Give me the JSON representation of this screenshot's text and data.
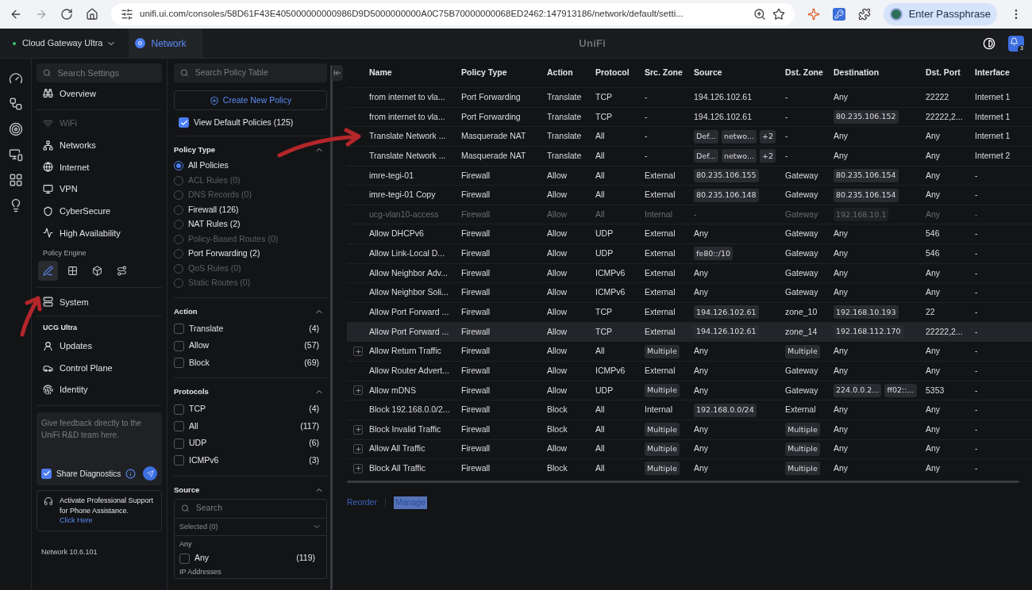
{
  "browser": {
    "url": "unifi.ui.com/consoles/58D61F43E405000000000986D9D5000000000A0C75B70000000068ED2462:147913186/network/default/setti...",
    "profile_button": "Enter Passphrase"
  },
  "header": {
    "console": "Cloud Gateway Ultra",
    "app_tab": "Network",
    "logo": "UniFi",
    "notification_count": "3"
  },
  "nav": {
    "search_placeholder": "Search Settings",
    "items": [
      {
        "label": "Overview",
        "disabled": false
      },
      {
        "label": "WiFi",
        "disabled": true
      },
      {
        "label": "Networks",
        "disabled": false
      },
      {
        "label": "Internet",
        "disabled": false
      },
      {
        "label": "VPN",
        "disabled": false
      },
      {
        "label": "CyberSecure",
        "disabled": false
      },
      {
        "label": "High Availability",
        "disabled": false
      }
    ],
    "policy_engine_label": "Policy Engine",
    "policy_tools": [
      {
        "selected": true
      },
      {
        "selected": false
      },
      {
        "selected": false
      },
      {
        "selected": false
      }
    ],
    "system": "System",
    "device_heading": "UCG Ultra",
    "device_items": [
      "Updates",
      "Control Plane",
      "Identity"
    ],
    "feedback_placeholder": "Give feedback directly to the UniFi R&D team here.",
    "share_diagnostics": {
      "label": "Share Diagnostics",
      "checked": true
    },
    "support": {
      "text": "Activate Professional Support for Phone Assistance.",
      "link": "Click Here"
    },
    "version": "Network 10.6.101"
  },
  "filters": {
    "search_placeholder": "Search Policy Table",
    "create_button": "Create New Policy",
    "view_default": {
      "label": "View Default Policies (125)",
      "checked": true
    },
    "policy_type": {
      "title": "Policy Type",
      "options": [
        {
          "label": "All Policies",
          "selected": true,
          "disabled": false
        },
        {
          "label": "ACL Rules (0)",
          "selected": false,
          "disabled": true
        },
        {
          "label": "DNS Records (0)",
          "selected": false,
          "disabled": true
        },
        {
          "label": "Firewall (126)",
          "selected": false,
          "disabled": false
        },
        {
          "label": "NAT Rules (2)",
          "selected": false,
          "disabled": false
        },
        {
          "label": "Policy-Based Routes (0)",
          "selected": false,
          "disabled": true
        },
        {
          "label": "Port Forwarding (2)",
          "selected": false,
          "disabled": false
        },
        {
          "label": "QoS Rules (0)",
          "selected": false,
          "disabled": true
        },
        {
          "label": "Static Routes (0)",
          "selected": false,
          "disabled": true
        }
      ]
    },
    "groups": [
      {
        "title": "Action",
        "options": [
          {
            "label": "Translate",
            "count": "(4)",
            "checked": false
          },
          {
            "label": "Allow",
            "count": "(57)",
            "checked": false
          },
          {
            "label": "Block",
            "count": "(69)",
            "checked": false
          }
        ]
      },
      {
        "title": "Protocols",
        "options": [
          {
            "label": "TCP",
            "count": "(4)",
            "checked": false
          },
          {
            "label": "All",
            "count": "(117)",
            "checked": false
          },
          {
            "label": "UDP",
            "count": "(6)",
            "checked": false
          },
          {
            "label": "ICMPv6",
            "count": "(3)",
            "checked": false
          }
        ]
      }
    ],
    "source": {
      "title": "Source",
      "search_placeholder": "Search",
      "selected_dropdown": "Selected (0)",
      "group_label": "Any",
      "option": {
        "label": "Any",
        "count": "(119)",
        "checked": false
      },
      "next_group_label": "IP Addresses"
    }
  },
  "table": {
    "columns": [
      "Name",
      "Policy Type",
      "Action",
      "Protocol",
      "Src. Zone",
      "Source",
      "Dst. Zone",
      "Destination",
      "Dst. Port",
      "Interface"
    ],
    "rows": [
      {
        "expandable": false,
        "disabled": false,
        "hovered": false,
        "cells": [
          "from internet to vla...",
          "Port Forwarding",
          "Translate",
          "TCP",
          "-",
          "194.126.102.61",
          "-",
          "Any",
          "22222",
          "Internet 1"
        ]
      },
      {
        "expandable": false,
        "disabled": false,
        "hovered": false,
        "cells": [
          "from internet to vla...",
          "Port Forwarding",
          "Translate",
          "TCP",
          "-",
          "194.126.102.61",
          "-",
          [
            "80.235.106.152"
          ],
          "22222,2...",
          "Internet 1"
        ]
      },
      {
        "expandable": false,
        "disabled": false,
        "hovered": false,
        "cells": [
          "Translate Network ...",
          "Masquerade NAT",
          "Translate",
          "All",
          "-",
          [
            "Def...",
            "netwo...",
            "+2"
          ],
          "-",
          "Any",
          "Any",
          "Internet 1"
        ]
      },
      {
        "expandable": false,
        "disabled": false,
        "hovered": false,
        "cells": [
          "Translate Network ...",
          "Masquerade NAT",
          "Translate",
          "All",
          "-",
          [
            "Def...",
            "netwo...",
            "+2"
          ],
          "-",
          "Any",
          "Any",
          "Internet 2"
        ]
      },
      {
        "expandable": false,
        "disabled": false,
        "hovered": false,
        "cells": [
          "imre-tegi-01",
          "Firewall",
          "Allow",
          "All",
          "External",
          [
            "80.235.106.155"
          ],
          "Gateway",
          [
            "80.235.106.154"
          ],
          "Any",
          "-"
        ]
      },
      {
        "expandable": false,
        "disabled": false,
        "hovered": false,
        "cells": [
          "imre-tegi-01 Copy",
          "Firewall",
          "Allow",
          "All",
          "External",
          [
            "80.235.106.148"
          ],
          "Gateway",
          [
            "80.235.106.154"
          ],
          "Any",
          "-"
        ]
      },
      {
        "expandable": false,
        "disabled": true,
        "hovered": false,
        "cells": [
          "ucg-vlan10-access",
          "Firewall",
          "Allow",
          "All",
          "Internal",
          "-",
          "Gateway",
          [
            "192.168.10.1"
          ],
          "Any",
          "-"
        ]
      },
      {
        "expandable": false,
        "disabled": false,
        "hovered": false,
        "cells": [
          "Allow DHCPv6",
          "Firewall",
          "Allow",
          "UDP",
          "External",
          "Any",
          "Gateway",
          "Any",
          "546",
          "-"
        ]
      },
      {
        "expandable": false,
        "disabled": false,
        "hovered": false,
        "cells": [
          "Allow Link-Local D...",
          "Firewall",
          "Allow",
          "UDP",
          "External",
          [
            "fe80::/10"
          ],
          "Gateway",
          "Any",
          "546",
          "-"
        ]
      },
      {
        "expandable": false,
        "disabled": false,
        "hovered": false,
        "cells": [
          "Allow Neighbor Adv...",
          "Firewall",
          "Allow",
          "ICMPv6",
          "External",
          "Any",
          "Gateway",
          "Any",
          "Any",
          "-"
        ]
      },
      {
        "expandable": false,
        "disabled": false,
        "hovered": false,
        "cells": [
          "Allow Neighbor Soli...",
          "Firewall",
          "Allow",
          "ICMPv6",
          "External",
          "Any",
          "Gateway",
          "Any",
          "Any",
          "-"
        ]
      },
      {
        "expandable": false,
        "disabled": false,
        "hovered": false,
        "cells": [
          "Allow Port Forward ...",
          "Firewall",
          "Allow",
          "TCP",
          "External",
          [
            "194.126.102.61"
          ],
          "zone_10",
          [
            "192.168.10.193"
          ],
          "22",
          "-"
        ]
      },
      {
        "expandable": false,
        "disabled": false,
        "hovered": true,
        "cells": [
          "Allow Port Forward ...",
          "Firewall",
          "Allow",
          "TCP",
          "External",
          [
            "194.126.102.61"
          ],
          "zone_14",
          [
            "192.168.112.170"
          ],
          "22222,2...",
          "-"
        ]
      },
      {
        "expandable": true,
        "disabled": false,
        "hovered": false,
        "cells": [
          "Allow Return Traffic",
          "Firewall",
          "Allow",
          "All",
          [
            "Multiple"
          ],
          "Any",
          [
            "Multiple"
          ],
          "Any",
          "Any",
          "-"
        ]
      },
      {
        "expandable": false,
        "disabled": false,
        "hovered": false,
        "cells": [
          "Allow Router Advert...",
          "Firewall",
          "Allow",
          "ICMPv6",
          "External",
          "Any",
          "Gateway",
          "Any",
          "Any",
          "-"
        ]
      },
      {
        "expandable": true,
        "disabled": false,
        "hovered": false,
        "cells": [
          "Allow mDNS",
          "Firewall",
          "Allow",
          "UDP",
          [
            "Multiple"
          ],
          "Any",
          "Gateway",
          [
            "224.0.0.2...",
            "ff02::..."
          ],
          "5353",
          "-"
        ]
      },
      {
        "expandable": false,
        "disabled": false,
        "hovered": false,
        "cells": [
          "Block 192.168.0.0/2...",
          "Firewall",
          "Block",
          "All",
          "Internal",
          [
            "192.168.0.0/24"
          ],
          "External",
          "Any",
          "Any",
          "-"
        ]
      },
      {
        "expandable": true,
        "disabled": false,
        "hovered": false,
        "cells": [
          "Block Invalid Traffic",
          "Firewall",
          "Block",
          "All",
          [
            "Multiple"
          ],
          "Any",
          [
            "Multiple"
          ],
          "Any",
          "Any",
          "-"
        ]
      },
      {
        "expandable": true,
        "disabled": false,
        "hovered": false,
        "cells": [
          "Allow All Traffic",
          "Firewall",
          "Allow",
          "All",
          [
            "Multiple"
          ],
          "Any",
          [
            "Multiple"
          ],
          "Any",
          "Any",
          "-"
        ]
      },
      {
        "expandable": true,
        "disabled": false,
        "hovered": false,
        "cells": [
          "Block All Traffic",
          "Firewall",
          "Block",
          "All",
          [
            "Multiple"
          ],
          "Any",
          [
            "Multiple"
          ],
          "Any",
          "Any",
          "-"
        ]
      }
    ],
    "footer_links": [
      {
        "label": "Reorder",
        "text_selected": false
      },
      {
        "label": "Manage",
        "text_selected": true
      }
    ]
  }
}
